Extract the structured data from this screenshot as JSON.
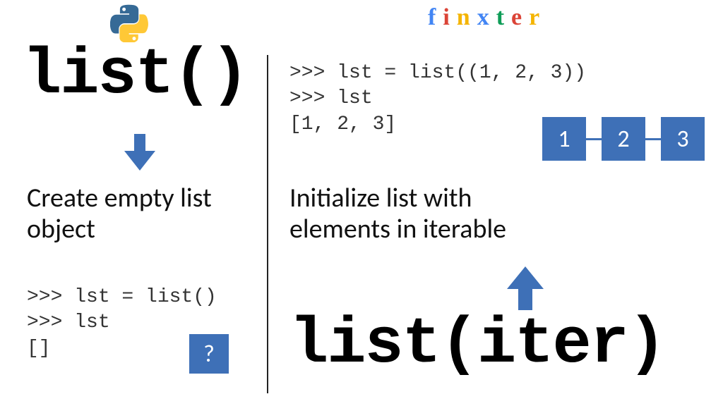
{
  "brand": {
    "letters": [
      "f",
      "i",
      "n",
      "x",
      "t",
      "e",
      "r"
    ]
  },
  "left": {
    "title": "list()",
    "description_line1": "Create empty list",
    "description_line2": "object",
    "code": ">>> lst = list()\n>>> lst\n[]",
    "question": "?"
  },
  "right": {
    "code": ">>> lst = list((1, 2, 3))\n>>> lst\n[1, 2, 3]",
    "nodes": [
      "1",
      "2",
      "3"
    ],
    "description_line1": "Initialize list with",
    "description_line2": "elements in iterable",
    "title": "list(iter)"
  },
  "colors": {
    "accent": "#3E70B7"
  }
}
